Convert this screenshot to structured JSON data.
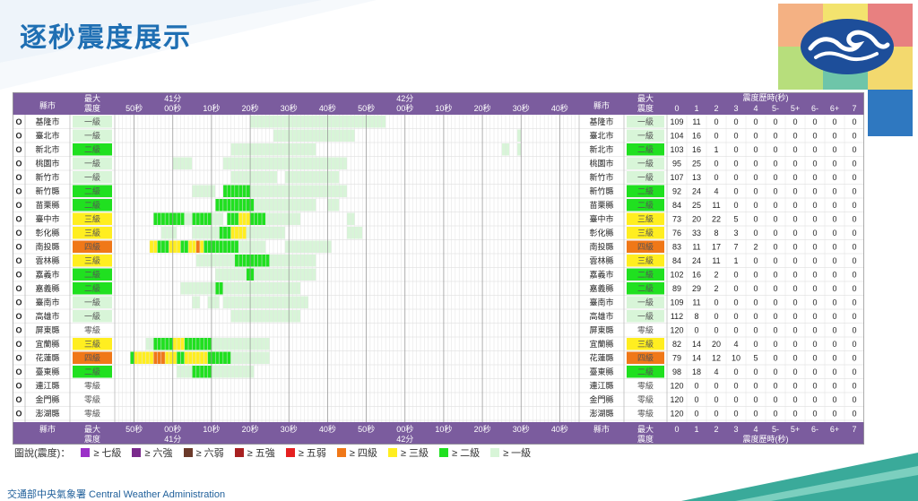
{
  "title": "逐秒震度展示",
  "footer": "交通部中央氣象署 Central Weather Administration",
  "header": {
    "county": "縣市",
    "maxInt": "最大震度",
    "history": "震度歷時(秒)",
    "minuteLabels": [
      "41分",
      "42分"
    ],
    "secLabels": [
      "50秒",
      "00秒",
      "10秒",
      "20秒",
      "30秒",
      "40秒",
      "50秒",
      "00秒",
      "10秒",
      "20秒",
      "30秒",
      "40秒"
    ],
    "histCols": [
      "0",
      "1",
      "2",
      "3",
      "4",
      "5-",
      "5+",
      "6-",
      "6+",
      "7"
    ]
  },
  "legend": {
    "prefix": "圖說(震度)：",
    "items": [
      {
        "label": "≥ 七級",
        "color": "#9b30c8"
      },
      {
        "label": "≥ 六強",
        "color": "#7a2a8c"
      },
      {
        "label": "≥ 六弱",
        "color": "#6b3a2a"
      },
      {
        "label": "≥ 五強",
        "color": "#a82020"
      },
      {
        "label": "≥ 五弱",
        "color": "#e52020"
      },
      {
        "label": "≥ 四級",
        "color": "#f07818"
      },
      {
        "label": "≥ 三級",
        "color": "#ffee20"
      },
      {
        "label": "≥ 二級",
        "color": "#20e020"
      },
      {
        "label": "≥ 一級",
        "color": "#d8f5d8"
      }
    ]
  },
  "intColors": {
    "零級": "#ffffff",
    "一級": "#d8f5d8",
    "二級": "#20e020",
    "三級": "#ffee20",
    "四級": "#f07818"
  },
  "rows": [
    {
      "mark": "O",
      "county": "基隆市",
      "max": "一級",
      "hist": [
        "109",
        "11",
        "0",
        "0",
        "0",
        "0",
        "0",
        "0",
        "0",
        "0"
      ]
    },
    {
      "mark": "O",
      "county": "臺北市",
      "max": "一級",
      "hist": [
        "104",
        "16",
        "0",
        "0",
        "0",
        "0",
        "0",
        "0",
        "0",
        "0"
      ]
    },
    {
      "mark": "O",
      "county": "新北市",
      "max": "二級",
      "hist": [
        "103",
        "16",
        "1",
        "0",
        "0",
        "0",
        "0",
        "0",
        "0",
        "0"
      ]
    },
    {
      "mark": "O",
      "county": "桃園市",
      "max": "一級",
      "hist": [
        "95",
        "25",
        "0",
        "0",
        "0",
        "0",
        "0",
        "0",
        "0",
        "0"
      ]
    },
    {
      "mark": "O",
      "county": "新竹市",
      "max": "一級",
      "hist": [
        "107",
        "13",
        "0",
        "0",
        "0",
        "0",
        "0",
        "0",
        "0",
        "0"
      ]
    },
    {
      "mark": "O",
      "county": "新竹縣",
      "max": "二級",
      "hist": [
        "92",
        "24",
        "4",
        "0",
        "0",
        "0",
        "0",
        "0",
        "0",
        "0"
      ]
    },
    {
      "mark": "O",
      "county": "苗栗縣",
      "max": "二級",
      "hist": [
        "84",
        "25",
        "11",
        "0",
        "0",
        "0",
        "0",
        "0",
        "0",
        "0"
      ]
    },
    {
      "mark": "O",
      "county": "臺中市",
      "max": "三級",
      "hist": [
        "73",
        "20",
        "22",
        "5",
        "0",
        "0",
        "0",
        "0",
        "0",
        "0"
      ]
    },
    {
      "mark": "O",
      "county": "彰化縣",
      "max": "三級",
      "hist": [
        "76",
        "33",
        "8",
        "3",
        "0",
        "0",
        "0",
        "0",
        "0",
        "0"
      ]
    },
    {
      "mark": "O",
      "county": "南投縣",
      "max": "四級",
      "hist": [
        "83",
        "11",
        "17",
        "7",
        "2",
        "0",
        "0",
        "0",
        "0",
        "0"
      ]
    },
    {
      "mark": "O",
      "county": "雲林縣",
      "max": "三級",
      "hist": [
        "84",
        "24",
        "11",
        "1",
        "0",
        "0",
        "0",
        "0",
        "0",
        "0"
      ]
    },
    {
      "mark": "O",
      "county": "嘉義市",
      "max": "二級",
      "hist": [
        "102",
        "16",
        "2",
        "0",
        "0",
        "0",
        "0",
        "0",
        "0",
        "0"
      ]
    },
    {
      "mark": "O",
      "county": "嘉義縣",
      "max": "二級",
      "hist": [
        "89",
        "29",
        "2",
        "0",
        "0",
        "0",
        "0",
        "0",
        "0",
        "0"
      ]
    },
    {
      "mark": "O",
      "county": "臺南市",
      "max": "一級",
      "hist": [
        "109",
        "11",
        "0",
        "0",
        "0",
        "0",
        "0",
        "0",
        "0",
        "0"
      ]
    },
    {
      "mark": "O",
      "county": "高雄市",
      "max": "一級",
      "hist": [
        "112",
        "8",
        "0",
        "0",
        "0",
        "0",
        "0",
        "0",
        "0",
        "0"
      ]
    },
    {
      "mark": "O",
      "county": "屏東縣",
      "max": "零級",
      "hist": [
        "120",
        "0",
        "0",
        "0",
        "0",
        "0",
        "0",
        "0",
        "0",
        "0"
      ]
    },
    {
      "mark": "O",
      "county": "宜蘭縣",
      "max": "三級",
      "hist": [
        "82",
        "14",
        "20",
        "4",
        "0",
        "0",
        "0",
        "0",
        "0",
        "0"
      ]
    },
    {
      "mark": "O",
      "county": "花蓮縣",
      "max": "四級",
      "hist": [
        "79",
        "14",
        "12",
        "10",
        "5",
        "0",
        "0",
        "0",
        "0",
        "0"
      ]
    },
    {
      "mark": "O",
      "county": "臺東縣",
      "max": "二級",
      "hist": [
        "98",
        "18",
        "4",
        "0",
        "0",
        "0",
        "0",
        "0",
        "0",
        "0"
      ]
    },
    {
      "mark": "O",
      "county": "連江縣",
      "max": "零級",
      "hist": [
        "120",
        "0",
        "0",
        "0",
        "0",
        "0",
        "0",
        "0",
        "0",
        "0"
      ]
    },
    {
      "mark": "O",
      "county": "金門縣",
      "max": "零級",
      "hist": [
        "120",
        "0",
        "0",
        "0",
        "0",
        "0",
        "0",
        "0",
        "0",
        "0"
      ]
    },
    {
      "mark": "O",
      "county": "澎湖縣",
      "max": "零級",
      "hist": [
        "120",
        "0",
        "0",
        "0",
        "0",
        "0",
        "0",
        "0",
        "0",
        "0"
      ]
    }
  ],
  "timeline": {
    "seconds": 120,
    "start": "41分45秒",
    "segments": [
      [
        [
          35,
          70,
          1
        ]
      ],
      [
        [
          41,
          62,
          1
        ],
        [
          104,
          105,
          1
        ]
      ],
      [
        [
          30,
          38,
          1
        ],
        [
          38,
          52,
          1
        ],
        [
          100,
          102,
          1
        ],
        [
          104,
          105,
          1
        ]
      ],
      [
        [
          15,
          20,
          1
        ],
        [
          28,
          60,
          1
        ]
      ],
      [
        [
          30,
          42,
          1
        ],
        [
          44,
          58,
          1
        ]
      ],
      [
        [
          20,
          26,
          1
        ],
        [
          28,
          35,
          2
        ],
        [
          35,
          42,
          1
        ],
        [
          42,
          60,
          1
        ]
      ],
      [
        [
          26,
          36,
          2
        ],
        [
          36,
          52,
          1
        ],
        [
          55,
          58,
          1
        ]
      ],
      [
        [
          10,
          18,
          2
        ],
        [
          18,
          20,
          1
        ],
        [
          20,
          25,
          2
        ],
        [
          25,
          28,
          1
        ],
        [
          29,
          32,
          2
        ],
        [
          32,
          35,
          3
        ],
        [
          35,
          39,
          2
        ],
        [
          39,
          44,
          1
        ],
        [
          44,
          48,
          1
        ],
        [
          60,
          62,
          1
        ]
      ],
      [
        [
          12,
          16,
          1
        ],
        [
          20,
          27,
          1
        ],
        [
          27,
          30,
          2
        ],
        [
          30,
          34,
          3
        ],
        [
          34,
          40,
          1
        ],
        [
          40,
          44,
          1
        ],
        [
          60,
          64,
          1
        ]
      ],
      [
        [
          9,
          11,
          3
        ],
        [
          11,
          14,
          2
        ],
        [
          14,
          17,
          3
        ],
        [
          17,
          19,
          2
        ],
        [
          19,
          21,
          3
        ],
        [
          21,
          22,
          4
        ],
        [
          22,
          23,
          3
        ],
        [
          23,
          32,
          2
        ],
        [
          32,
          39,
          1
        ],
        [
          44,
          56,
          1
        ]
      ],
      [
        [
          21,
          31,
          1
        ],
        [
          31,
          36,
          2
        ],
        [
          36,
          40,
          2
        ],
        [
          40,
          52,
          1
        ]
      ],
      [
        [
          26,
          34,
          1
        ],
        [
          34,
          36,
          2
        ],
        [
          36,
          52,
          1
        ]
      ],
      [
        [
          17,
          22,
          1
        ],
        [
          22,
          26,
          1
        ],
        [
          26,
          28,
          2
        ],
        [
          28,
          40,
          1
        ],
        [
          40,
          48,
          1
        ]
      ],
      [
        [
          20,
          22,
          1
        ],
        [
          24,
          27,
          1
        ],
        [
          28,
          50,
          1
        ]
      ],
      [
        [
          30,
          36,
          1
        ],
        [
          36,
          48,
          1
        ]
      ],
      [],
      [
        [
          8,
          10,
          1
        ],
        [
          10,
          15,
          2
        ],
        [
          15,
          18,
          3
        ],
        [
          18,
          25,
          2
        ],
        [
          25,
          40,
          1
        ]
      ],
      [
        [
          4,
          5,
          2
        ],
        [
          5,
          10,
          3
        ],
        [
          10,
          13,
          4
        ],
        [
          13,
          16,
          3
        ],
        [
          16,
          18,
          2
        ],
        [
          18,
          24,
          3
        ],
        [
          24,
          30,
          2
        ],
        [
          30,
          36,
          1
        ],
        [
          36,
          40,
          1
        ]
      ],
      [
        [
          16,
          20,
          1
        ],
        [
          20,
          25,
          2
        ],
        [
          25,
          36,
          1
        ]
      ],
      [],
      [],
      []
    ]
  }
}
